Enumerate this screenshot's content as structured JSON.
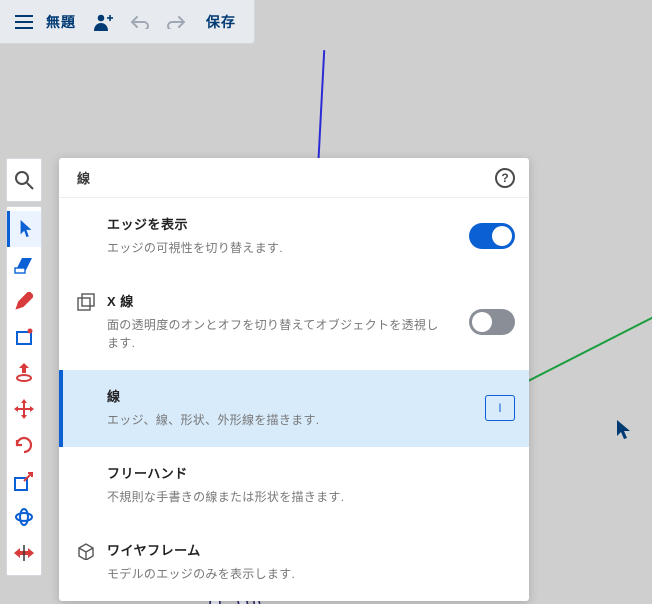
{
  "topbar": {
    "title": "無題",
    "save_label": "保存"
  },
  "panel": {
    "header": "線",
    "rows": [
      {
        "id": "edges",
        "title": "エッジを表示",
        "desc": "エッジの可視性を切り替えます.",
        "toggle": true
      },
      {
        "id": "xray",
        "title": "X 線",
        "desc": "面の透明度のオンとオフを切り替えてオブジェクトを透視します.",
        "toggle": false
      },
      {
        "id": "line",
        "title": "線",
        "desc": "エッジ、線、形状、外形線を描きます.",
        "shortcut": "l"
      },
      {
        "id": "freehand",
        "title": "フリーハンド",
        "desc": "不規則な手書きの線または形状を描きます."
      },
      {
        "id": "wireframe",
        "title": "ワイヤフレーム",
        "desc": "モデルのエッジのみを表示します."
      }
    ]
  },
  "sidebar_tools": [
    "select",
    "eraser",
    "pencil",
    "rectangle",
    "pushpull",
    "move",
    "rotate",
    "transform",
    "orbit",
    "flip"
  ]
}
